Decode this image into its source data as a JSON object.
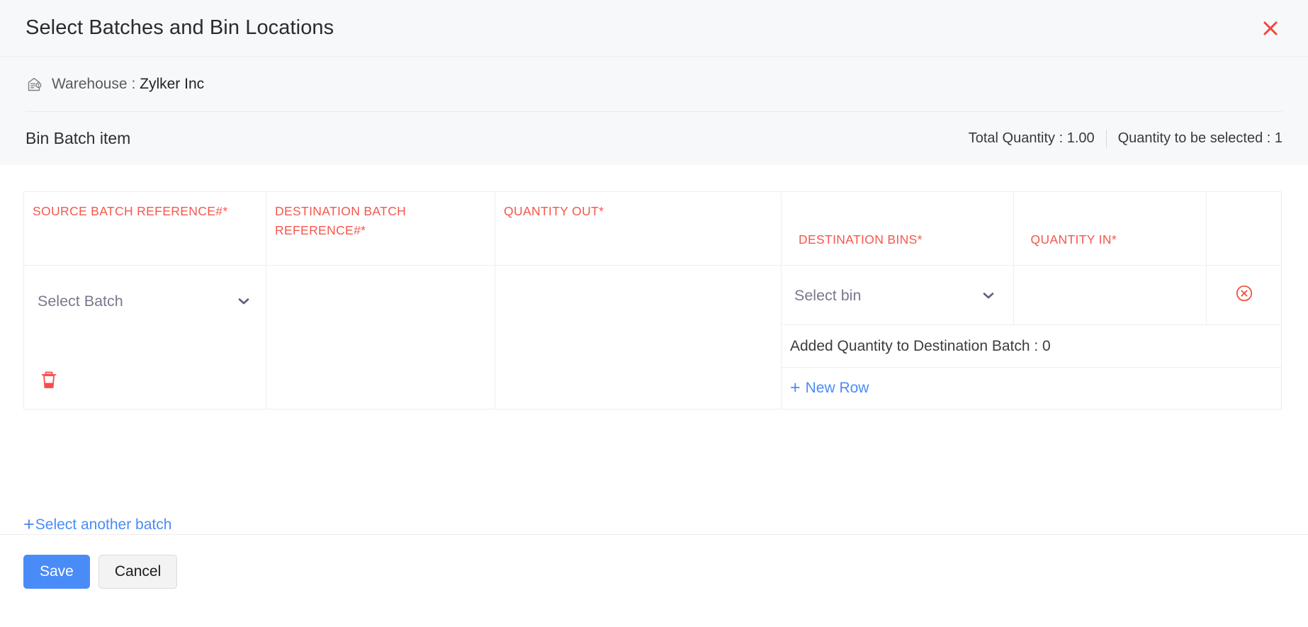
{
  "header": {
    "title": "Select Batches and Bin Locations",
    "close_icon": "close-icon",
    "close_color": "#f9423a"
  },
  "info": {
    "warehouse_icon": "warehouse-icon",
    "warehouse_label": "Warehouse : ",
    "warehouse_value": "Zylker Inc",
    "item_name": "Bin Batch item",
    "total_quantity": "Total Quantity : 1.00",
    "quantity_to_be_selected": "Quantity to be selected : 1"
  },
  "table": {
    "headers": {
      "source_batch_reference": "SOURCE BATCH REFERENCE#*",
      "destination_batch_reference": "DESTINATION BATCH REFERENCE#*",
      "quantity_out": "QUANTITY OUT*",
      "destination_bins": "DESTINATION BINS*",
      "quantity_in": "QUANTITY IN*",
      "actions": ""
    },
    "header_color": "#f4574c",
    "rows": [
      {
        "source_batch_placeholder": "Select Batch",
        "source_batch_value": "",
        "destination_batch_value": "",
        "quantity_out_value": "",
        "chevron_icon": "chevron-down-icon",
        "delete_icon": "trash-icon",
        "bins": [
          {
            "bin_placeholder": "Select bin",
            "bin_value": "",
            "quantity_in_value": "",
            "remove_icon": "remove-circle-icon"
          }
        ],
        "added_quantity_text": "Added Quantity to Destination Batch : 0",
        "new_row_label": "New Row",
        "new_row_icon": "plus-icon"
      }
    ]
  },
  "actions": {
    "select_another_batch": "Select another batch",
    "select_another_batch_icon": "plus-icon",
    "link_color": "#4a8cf7"
  },
  "footer": {
    "save_label": "Save",
    "cancel_label": "Cancel",
    "save_color": "#4a8cf7"
  }
}
